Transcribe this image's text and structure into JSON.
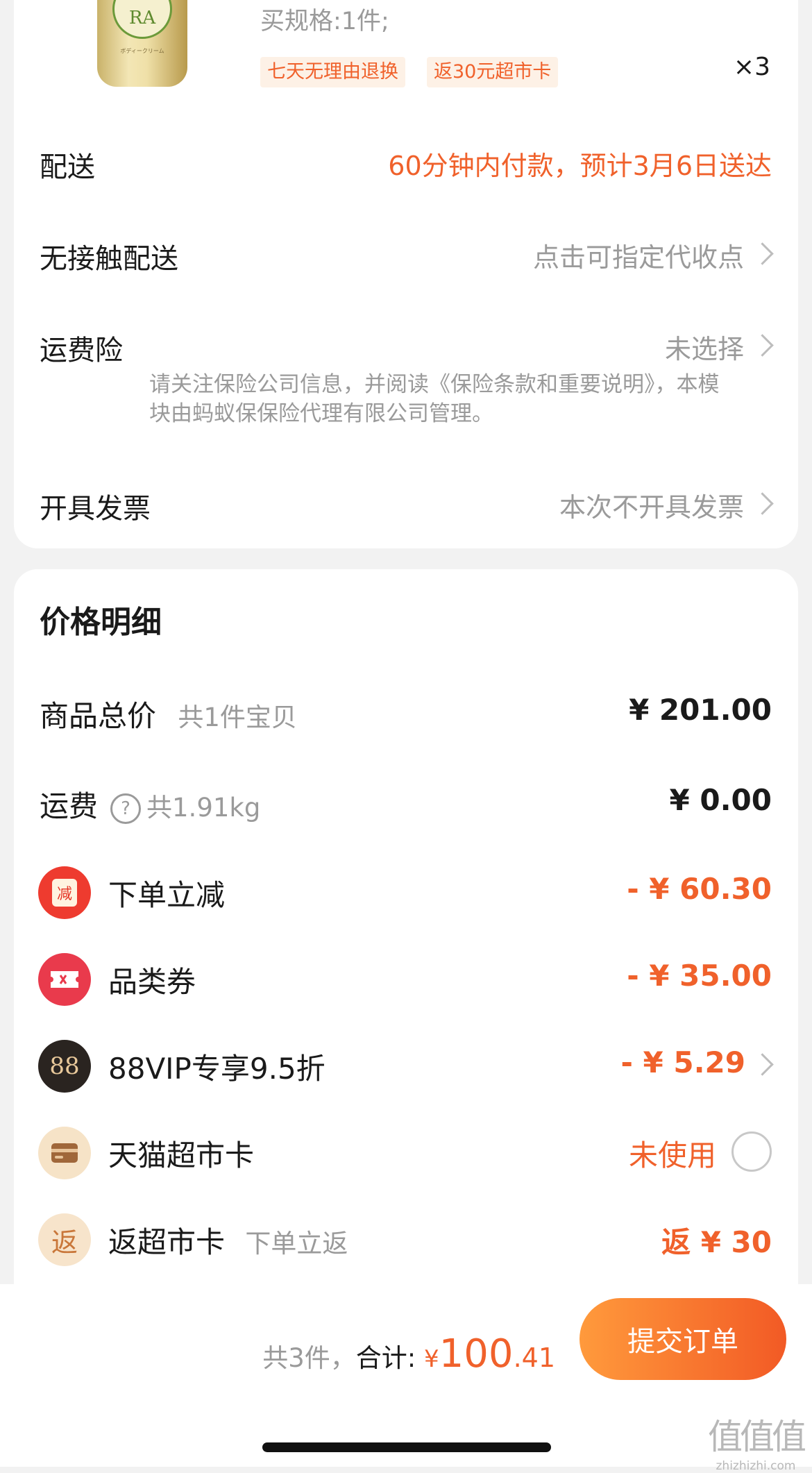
{
  "product": {
    "image_text": "ボディークリーム",
    "logo_text": "RA",
    "spec": "买规格:1件;",
    "tags": [
      "七天无理由退换",
      "返30元超市卡"
    ],
    "quantity": "×3"
  },
  "rows": {
    "delivery": {
      "label": "配送",
      "value": "60分钟内付款，预计3月6日送达"
    },
    "contactless": {
      "label": "无接触配送",
      "value": "点击可指定代收点"
    },
    "insurance": {
      "label": "运费险",
      "value": "未选择",
      "note": "请关注保险公司信息，并阅读《保险条款和重要说明》，本模块由蚂蚁保保险代理有限公司管理。"
    },
    "invoice": {
      "label": "开具发票",
      "value": "本次不开具发票"
    }
  },
  "price": {
    "title": "价格明细",
    "goods_total": {
      "label": "商品总价",
      "sub": "共1件宝贝",
      "amount": "¥ 201.00"
    },
    "shipping": {
      "label": "运费",
      "help": "?",
      "sub": "共1.91kg",
      "amount": "¥ 0.00"
    },
    "discounts": [
      {
        "label": "下单立减",
        "icon_text": "减",
        "icon": "red-packet-icon",
        "amount": "- ¥ 60.30"
      },
      {
        "label": "品类券",
        "icon": "coupon-icon",
        "amount": "- ¥ 35.00"
      },
      {
        "label": "88VIP专享9.5折",
        "icon_text": "88",
        "icon": "88vip-icon",
        "amount": "- ¥ 5.29"
      },
      {
        "label": "天猫超市卡",
        "icon": "card-icon",
        "amount": "未使用"
      },
      {
        "label": "返超市卡",
        "icon_text": "返",
        "sub": "下单立返",
        "icon": "rebate-icon",
        "amount": "返 ¥ 30"
      }
    ]
  },
  "footer": {
    "count": "共3件，",
    "total_label": "合计:",
    "currency": "¥",
    "total_int": "100",
    "total_dec": ".41",
    "submit": "提交订单"
  },
  "watermark": {
    "main": "值值值",
    "sub": "zhizhizhi.com"
  },
  "colors": {
    "accent": "#f0612b",
    "muted": "#9a9a9a",
    "background": "#f2f2f2"
  }
}
